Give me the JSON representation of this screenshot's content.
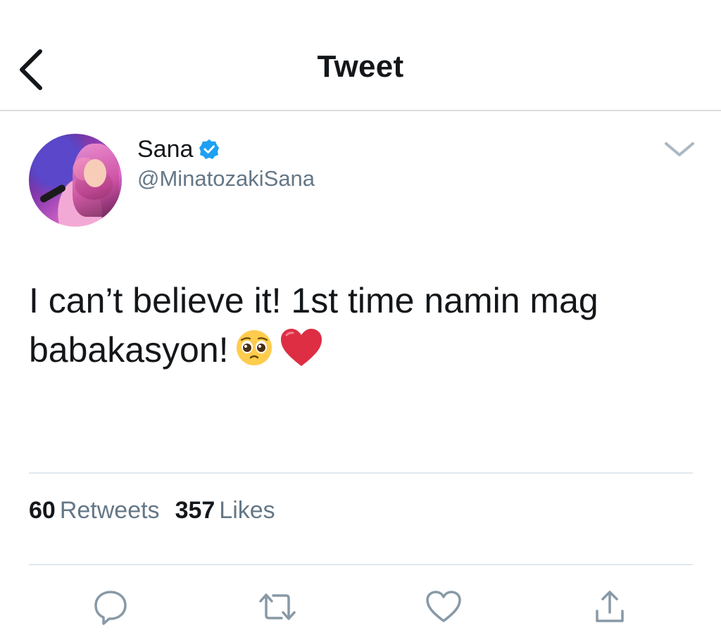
{
  "header": {
    "title": "Tweet",
    "back_icon": "chevron-left-icon"
  },
  "author": {
    "name": "Sana",
    "handle": "@MinatozakiSana",
    "verified": true,
    "verified_color": "#1da1f2"
  },
  "tweet": {
    "text": "I can’t believe it! 1st time namin mag babakasyon!",
    "emojis": [
      "pleading-face-icon",
      "red-heart-icon"
    ]
  },
  "stats": {
    "retweets_count": "60",
    "retweets_label": "Retweets",
    "likes_count": "357",
    "likes_label": "Likes"
  },
  "actions": [
    "reply-icon",
    "retweet-icon",
    "like-icon",
    "share-icon"
  ],
  "colors": {
    "text": "#14171a",
    "secondary": "#657786",
    "divider": "#e1e8ed",
    "action_icon": "#8899a6",
    "heart": "#dd2e44"
  }
}
